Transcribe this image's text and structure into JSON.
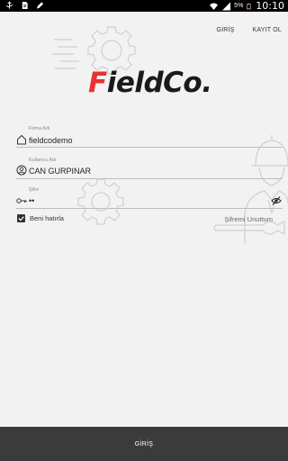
{
  "status_bar": {
    "battery_percent": "5%",
    "time": "10:10",
    "icons": [
      "usb-icon",
      "file-icon",
      "pencil-icon",
      "wifi-icon",
      "signal-icon",
      "battery-icon"
    ]
  },
  "nav": {
    "login_label": "GİRİŞ",
    "register_label": "KAYIT OL"
  },
  "logo": {
    "first_letter": "F",
    "rest": "ieldCo."
  },
  "form": {
    "company": {
      "label": "Firma Adı",
      "value": "fieldcodemo",
      "icon": "home-icon"
    },
    "username": {
      "label": "Kullanıcı Adı",
      "value": "CAN GURPINAR",
      "icon": "user-circle-icon"
    },
    "password": {
      "label": "Şifre",
      "value": "••",
      "icon": "key-icon",
      "toggle_icon": "eye-off-icon"
    },
    "remember_label": "Beni hatırla",
    "remember_checked": true,
    "forgot_label": "Şifremi Unuttum"
  },
  "footer": {
    "login_button_label": "GİRİŞ"
  },
  "colors": {
    "accent": "#e8322f",
    "background": "#f2f2f2",
    "bottom_bar": "#3b3b3b"
  }
}
